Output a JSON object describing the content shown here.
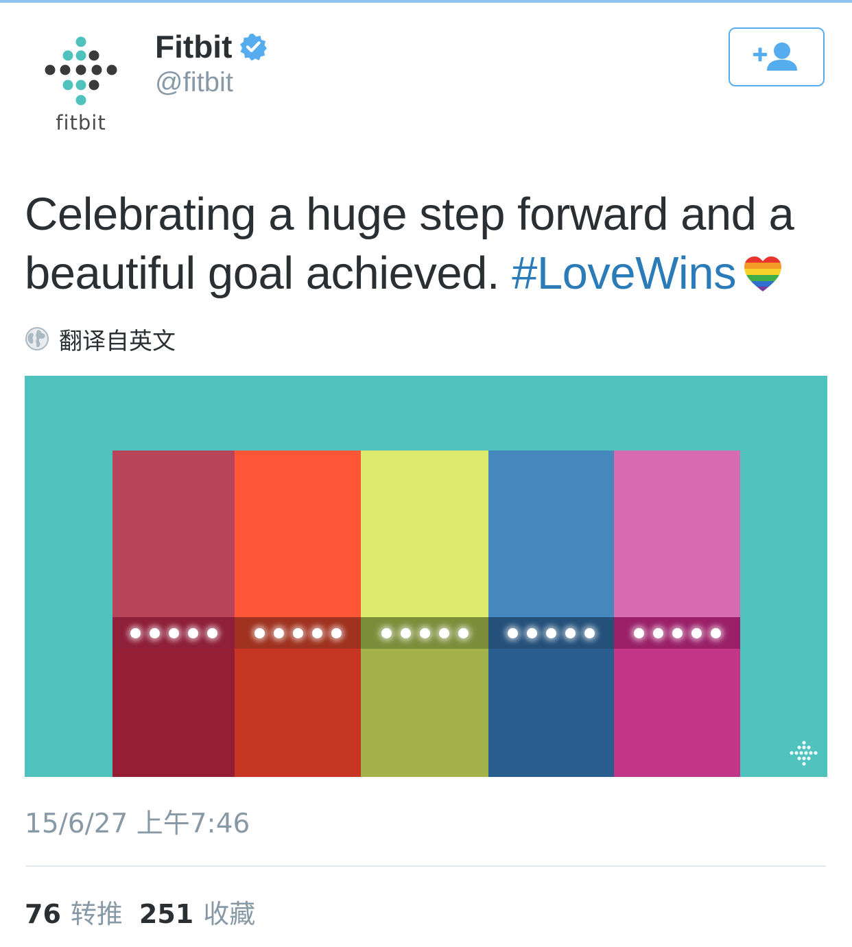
{
  "header": {
    "display_name": "Fitbit",
    "handle": "@fitbit",
    "avatar_wordmark": "fitbit",
    "verified": true,
    "follow_icon": "add-user-icon"
  },
  "tweet": {
    "text_part1": "Celebrating a huge step forward and a beautiful goal achieved. ",
    "hashtag": "#LoveWins",
    "emoji": "rainbow-heart-icon"
  },
  "translate": {
    "label": "翻译自英文",
    "icon": "globe-icon"
  },
  "media": {
    "background": "#4fc2be",
    "bands": [
      {
        "top": "#b8445a",
        "bottom": "#951d34",
        "strip": "#8f1f3a"
      },
      {
        "top": "#fe5637",
        "bottom": "#c63623",
        "strip": "#a0321f"
      },
      {
        "top": "#dceb6e",
        "bottom": "#a3b24a",
        "strip": "#7d8e3b"
      },
      {
        "top": "#4588bd",
        "bottom": "#285d8e",
        "strip": "#24507a"
      },
      {
        "top": "#d76bb0",
        "bottom": "#c13686",
        "strip": "#9b2068"
      }
    ]
  },
  "meta": {
    "timestamp": "15/6/27 上午7:46"
  },
  "stats": {
    "retweets_count": "76",
    "retweets_label": "转推",
    "likes_count": "251",
    "likes_label": "收藏"
  },
  "colors": {
    "accent": "#55acee",
    "hashtag": "#2b7bb9",
    "muted": "#8899a6",
    "text": "#292f33"
  }
}
